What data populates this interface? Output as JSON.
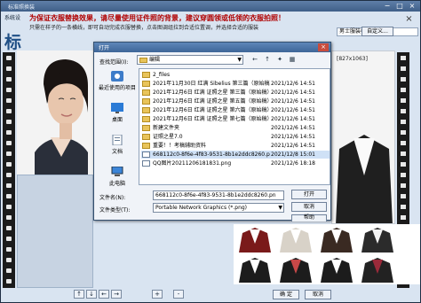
{
  "window": {
    "title": "标准照换装",
    "menu_tab": "系统设",
    "instruction_main": "为保证衣服替换效果，请尽量使用证件照的背景，建议穿圆领或低领的衣服拍照！",
    "instruction_sub": "只需在样子的一条横线，即可自动完成衣服替换，点击图调组拉到合适位置调，并选择合适的服装",
    "big_char": "标",
    "close_label": "×"
  },
  "right_panel": {
    "category": "男士服装模板",
    "custom_button": "自定义...",
    "ok_button": "确 定",
    "cancel_button": "取消"
  },
  "bottom_toolbar": {
    "buttons": [
      "↑",
      "↓",
      "←",
      "→",
      "+",
      "-"
    ]
  },
  "dialog": {
    "title": "打开",
    "close": "×",
    "look_in_label": "查找范围(I):",
    "look_in_value": "编辑",
    "toolbar": [
      "←",
      "↑",
      "✦",
      "▦"
    ],
    "places": [
      {
        "label": "最近使用的项目",
        "icon": "recent-icon"
      },
      {
        "label": "桌面",
        "icon": "desktop-icon"
      },
      {
        "label": "文档",
        "icon": "documents-icon"
      },
      {
        "label": "此电脑",
        "icon": "computer-icon"
      }
    ],
    "files": [
      {
        "name": "2_files",
        "date": "",
        "type": "folder"
      },
      {
        "name": "2021年11月30日 红满 Sibelius 第三篇（原始稿）",
        "date": "2021/12/6 14:51",
        "type": "folder"
      },
      {
        "name": "2021年12月6日 红满 证照之星 第三篇（原始稿）",
        "date": "2021/12/6 14:51",
        "type": "folder"
      },
      {
        "name": "2021年12月6日 红满 证照之星 第五篇（原始稿）",
        "date": "2021/12/6 14:51",
        "type": "folder"
      },
      {
        "name": "2021年12月6日 红满 证照之星 第六篇（原始稿）",
        "date": "2021/12/6 14:51",
        "type": "folder"
      },
      {
        "name": "2021年12月6日 红满 证照之星 第七篇（原始稿）",
        "date": "2021/12/6 14:51",
        "type": "folder"
      },
      {
        "name": "新建文件夹",
        "date": "2021/12/6 14:51",
        "type": "folder"
      },
      {
        "name": "证照之星7.0",
        "date": "2021/12/6 14:51",
        "type": "folder"
      },
      {
        "name": "重要！！考稿辅助资料",
        "date": "2021/12/6 14:51",
        "type": "folder"
      },
      {
        "name": "668112c0-8f6e-4f83-9531-8b1e2ddc8260.png",
        "date": "2021/12/8 15:01",
        "type": "png",
        "selected": true
      },
      {
        "name": "QQ图片20211206181831.png",
        "date": "2021/12/6 18:18",
        "type": "png"
      }
    ],
    "file_name_label": "文件名(N):",
    "file_name_value": "668112c0-8f6e-4f83-9531-8b1e2ddc8260.pn",
    "file_type_label": "文件类型(T):",
    "file_type_value": "Portable Network Graphics (*.png)",
    "open_button": "打开",
    "cancel_button": "取消",
    "help_button": "帮助",
    "preview_dims": "[827x1063]"
  }
}
